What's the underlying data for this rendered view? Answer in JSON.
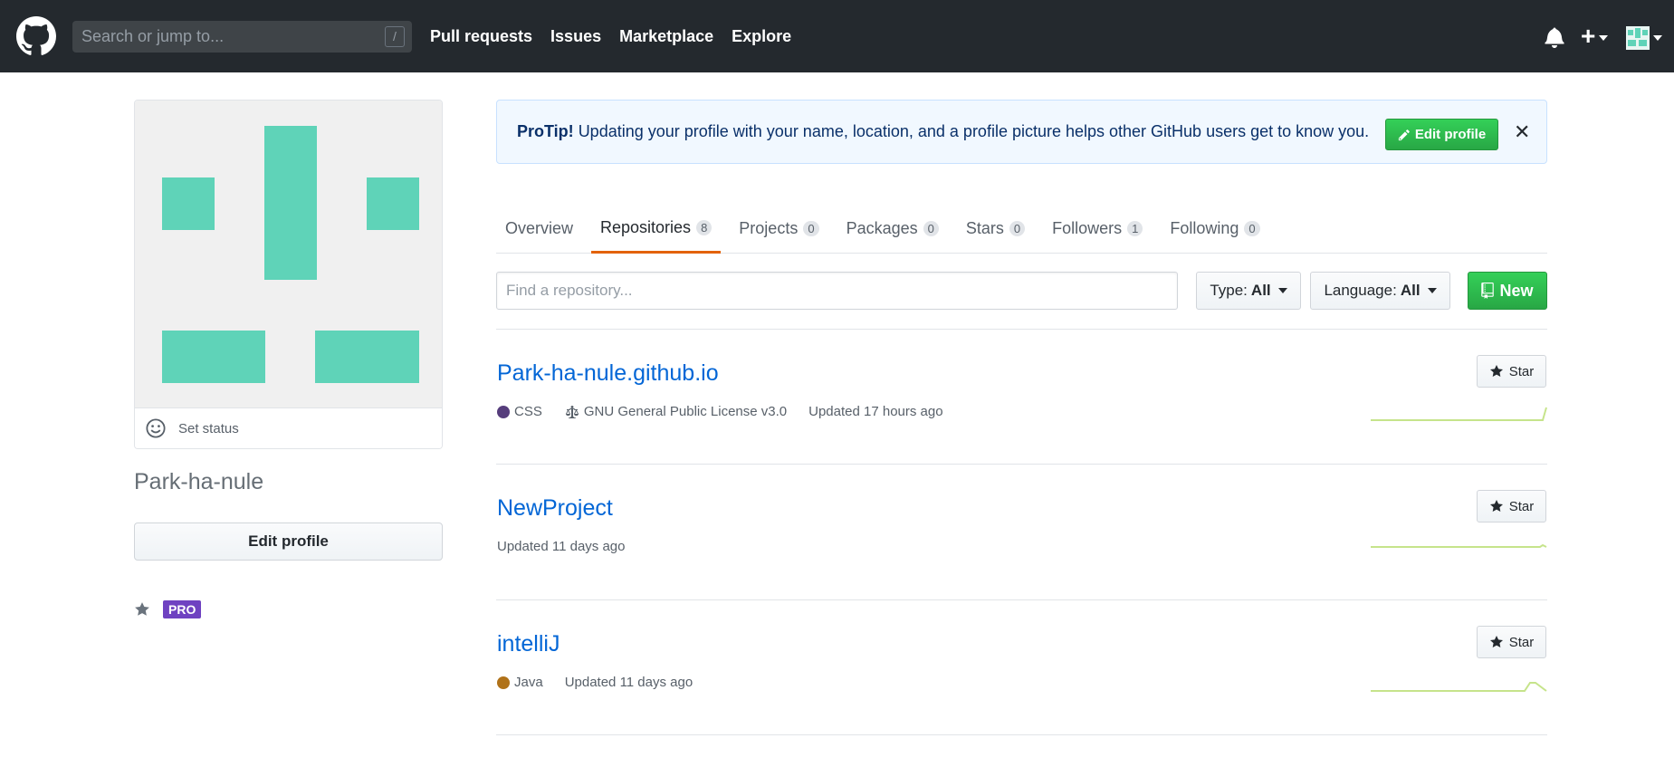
{
  "header": {
    "search_placeholder": "Search or jump to...",
    "search_shortcut": "/",
    "nav": [
      "Pull requests",
      "Issues",
      "Marketplace",
      "Explore"
    ]
  },
  "sidebar": {
    "set_status": "Set status",
    "username": "Park-ha-nule",
    "edit_profile": "Edit profile",
    "pro_badge": "PRO"
  },
  "protip": {
    "label": "ProTip!",
    "text": "Updating your profile with your name, location, and a profile picture helps other GitHub users get to know you.",
    "edit_button": "Edit profile",
    "close": "✕"
  },
  "tabs": [
    {
      "label": "Overview",
      "count": ""
    },
    {
      "label": "Repositories",
      "count": "8"
    },
    {
      "label": "Projects",
      "count": "0"
    },
    {
      "label": "Packages",
      "count": "0"
    },
    {
      "label": "Stars",
      "count": "0"
    },
    {
      "label": "Followers",
      "count": "1"
    },
    {
      "label": "Following",
      "count": "0"
    }
  ],
  "filters": {
    "find_placeholder": "Find a repository...",
    "type_label": "Type:",
    "type_value": "All",
    "language_label": "Language:",
    "language_value": "All",
    "new_button": "New"
  },
  "repos": [
    {
      "name": "Park-ha-nule.github.io",
      "language": "CSS",
      "language_color": "#563d7c",
      "license": "GNU General Public License v3.0",
      "updated": "Updated 17 hours ago",
      "star": "Star"
    },
    {
      "name": "NewProject",
      "language": "",
      "language_color": "",
      "license": "",
      "updated": "Updated 11 days ago",
      "star": "Star"
    },
    {
      "name": "intelliJ",
      "language": "Java",
      "language_color": "#b07219",
      "license": "",
      "updated": "Updated 11 days ago",
      "star": "Star"
    }
  ],
  "colors": {
    "header_bg": "#24292e",
    "link": "#0366d6",
    "green": "#28a745",
    "identicon": "#5fd3b8",
    "active_tab": "#e36209",
    "pro": "#6f42c1"
  }
}
